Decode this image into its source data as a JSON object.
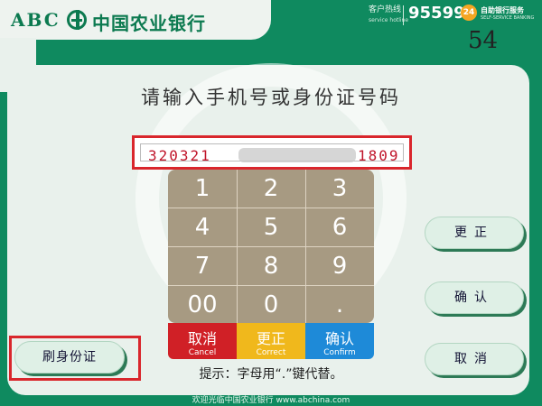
{
  "header": {
    "brand_latin": "ABC",
    "bank_name": "中国农业银行",
    "hotline_label": "客户热线",
    "hotline_en": "service hotline",
    "hotline_number": "95599",
    "self_service_badge": "24",
    "self_service_label": "自助银行服务",
    "self_service_en": "SELF-SERVICE BANKING"
  },
  "countdown": "54",
  "prompt": "请输入手机号或身份证号码",
  "input": {
    "value": "320321 1809",
    "value_prefix": "320321",
    "value_suffix": "1809",
    "masked": true
  },
  "keypad": {
    "keys": [
      "1",
      "2",
      "3",
      "4",
      "5",
      "6",
      "7",
      "8",
      "9",
      "00",
      "0",
      "."
    ],
    "cancel": {
      "cn": "取消",
      "en": "Cancel",
      "color": "#d02026"
    },
    "correct": {
      "cn": "更正",
      "en": "Correct",
      "color": "#f0b81c"
    },
    "confirm": {
      "cn": "确认",
      "en": "Confirm",
      "color": "#1e8ad8"
    }
  },
  "hint": "提示：字母用“.”键代替。",
  "side_buttons": {
    "correct": "更正",
    "confirm": "确认",
    "cancel": "取消",
    "id_card": "刷身份证"
  },
  "footer": "欢迎光临中国农业银行 www.abchina.com",
  "colors": {
    "brand_green": "#0f8a5f",
    "highlight_red": "#d9262c",
    "input_text_red": "#c0152a"
  }
}
